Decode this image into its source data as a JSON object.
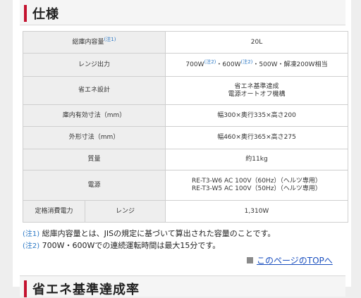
{
  "section_title": "仕様",
  "note_marks": {
    "note1": "(注1)",
    "note2": "(注2)"
  },
  "spec": {
    "capacity": {
      "label": "総庫内容量",
      "value": "20L"
    },
    "microwave_output": {
      "label": "レンジ出力",
      "v1": "700W",
      "sep1": "・600W",
      "sep2": "・500W・解凍200W相当"
    },
    "eco_design": {
      "label": "省エネ設計",
      "line1": "省エネ基準達成",
      "line2": "電源オートオフ機構"
    },
    "interior_dims": {
      "label": "庫内有効寸法（mm）",
      "value": "幅300×奥行335×高さ200"
    },
    "exterior_dims": {
      "label": "外形寸法（mm）",
      "value": "幅460×奥行365×高さ275"
    },
    "weight": {
      "label": "質量",
      "value": "約11kg"
    },
    "power": {
      "label": "電源",
      "line1": "RE-T3-W6 AC 100V（60Hz）（ヘルツ専用）",
      "line2": "RE-T3-W5 AC 100V（50Hz）（ヘルツ専用）"
    },
    "rated_power": {
      "label": "定格消費電力",
      "sub_label": "レンジ",
      "value": "1,310W"
    }
  },
  "notes": [
    {
      "mark": "(注1)",
      "text": "総庫内容量とは、JISの規定に基づいて算出された容量のことです。"
    },
    {
      "mark": "(注2)",
      "text": "700W・600Wでの連続運転時間は最大15分です。"
    }
  ],
  "top_link": "このページのTOPへ",
  "next_section_title": "省エネ基準達成率"
}
